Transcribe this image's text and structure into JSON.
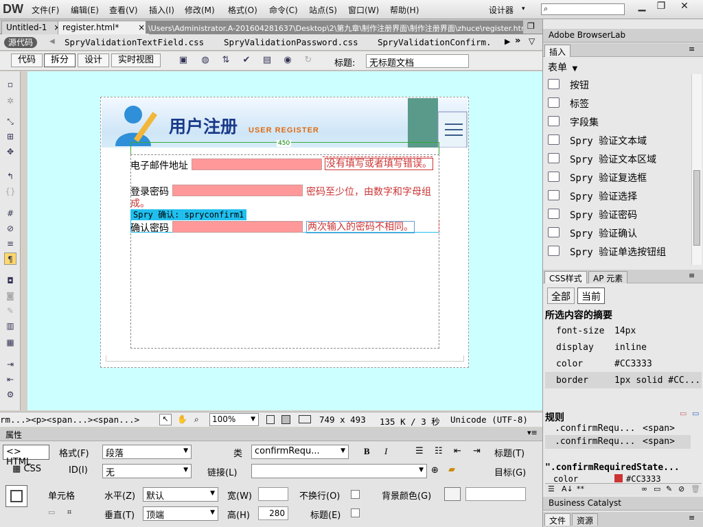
{
  "app": {
    "logo": "DW",
    "workspace": "设计器"
  },
  "menu": [
    "文件(F)",
    "编辑(E)",
    "查看(V)",
    "插入(I)",
    "修改(M)",
    "格式(O)",
    "命令(C)",
    "站点(S)",
    "窗口(W)",
    "帮助(H)"
  ],
  "doc_tabs": [
    {
      "label": "Untitled-1",
      "close": "×"
    },
    {
      "label": "register.html*",
      "close": "×"
    }
  ],
  "doc_path": "\\Users\\Administrator.A-201604281637\\Desktop\\2\\第九章\\制作注册界面\\制作注册界面\\zhuce\\register.html",
  "related": {
    "source": "源代码",
    "files": [
      "SpryValidationTextField.css",
      "SpryValidationPassword.css",
      "SpryValidationConfirm."
    ]
  },
  "toolbar": {
    "views": [
      "代码",
      "拆分",
      "设计",
      "实时视图"
    ],
    "title_label": "标题:",
    "title_value": "无标题文档"
  },
  "page": {
    "banner_title": "用户注册",
    "banner_sub": "USER REGISTER",
    "width_label": "450",
    "email_label": "电子邮件地址",
    "email_error": "没有填写或者填写错误。",
    "password_label": "登录密码",
    "password_hint_1": "密码至少位，由数字和字母组",
    "password_hint_2": "成。",
    "spry_tag": "Spry 确认: spryconfirm1",
    "confirm_label": "确认密码",
    "confirm_error": "两次输入的密码不相同。"
  },
  "status": {
    "tag_path": "rm...><p><span...><span...>",
    "zoom": "100%",
    "size": "749 x 493",
    "weight": "135 K / 3 秒",
    "encoding": "Unicode (UTF-8)"
  },
  "properties": {
    "title": "属性",
    "html_btn": "HTML",
    "css_btn": "CSS",
    "format_label": "格式(F)",
    "format_value": "段落",
    "class_label": "类",
    "class_value": "confirmRequ...",
    "bold": "B",
    "italic": "I",
    "heading_label": "标题(T)",
    "id_label": "ID(I)",
    "id_value": "无",
    "link_label": "链接(L)",
    "target_label": "目标(G)",
    "cell_label": "单元格",
    "horz_label": "水平(Z)",
    "horz_value": "默认",
    "width_label": "宽(W)",
    "nowrap_label": "不换行(O)",
    "bg_label": "背景颜色(G)",
    "vert_label": "垂直(T)",
    "vert_value": "顶端",
    "height_label": "高(H)",
    "height_value": "280",
    "header_label": "标题(E)"
  },
  "right": {
    "browserlab": "Adobe BrowserLab",
    "insert_tab": "插入",
    "category": "表单",
    "insert_items": [
      {
        "label": "按钮",
        "icon": "button-icon"
      },
      {
        "label": "标签",
        "icon": "label-icon"
      },
      {
        "label": "字段集",
        "icon": "fieldset-icon"
      },
      {
        "label": "Spry 验证文本域",
        "icon": "spry-textfield-icon"
      },
      {
        "label": "Spry 验证文本区域",
        "icon": "spry-textarea-icon"
      },
      {
        "label": "Spry 验证复选框",
        "icon": "spry-checkbox-icon"
      },
      {
        "label": "Spry 验证选择",
        "icon": "spry-select-icon"
      },
      {
        "label": "Spry 验证密码",
        "icon": "spry-password-icon"
      },
      {
        "label": "Spry 验证确认",
        "icon": "spry-confirm-icon"
      },
      {
        "label": "Spry 验证单选按钮组",
        "icon": "spry-radio-icon"
      }
    ],
    "css_tab": "CSS样式",
    "ap_tab": "AP 元素",
    "all_btn": "全部",
    "current_btn": "当前",
    "summary_title": "所选内容的摘要",
    "summary": [
      {
        "prop": "font-size",
        "val": "14px"
      },
      {
        "prop": "display",
        "val": "inline"
      },
      {
        "prop": "color",
        "val": "#CC3333"
      },
      {
        "prop": "border",
        "val": "1px solid #CC..."
      }
    ],
    "rules_title": "规则",
    "rules": [
      {
        "sel": ".confirmRequ...",
        "tag": "<span>"
      },
      {
        "sel": ".confirmRequ...",
        "tag": "<span>"
      }
    ],
    "rule_name": "\".confirmRequiredState...",
    "rule_prop": "color",
    "rule_val": "#CC3333",
    "business": "Business Catalyst",
    "files_tab": "文件",
    "assets_tab": "资源"
  },
  "colors": {
    "canvas_bg": "#CCFFFF",
    "error": "#CC3333",
    "field_fill": "#FF9999",
    "spry_tag": "#20BFEE"
  }
}
